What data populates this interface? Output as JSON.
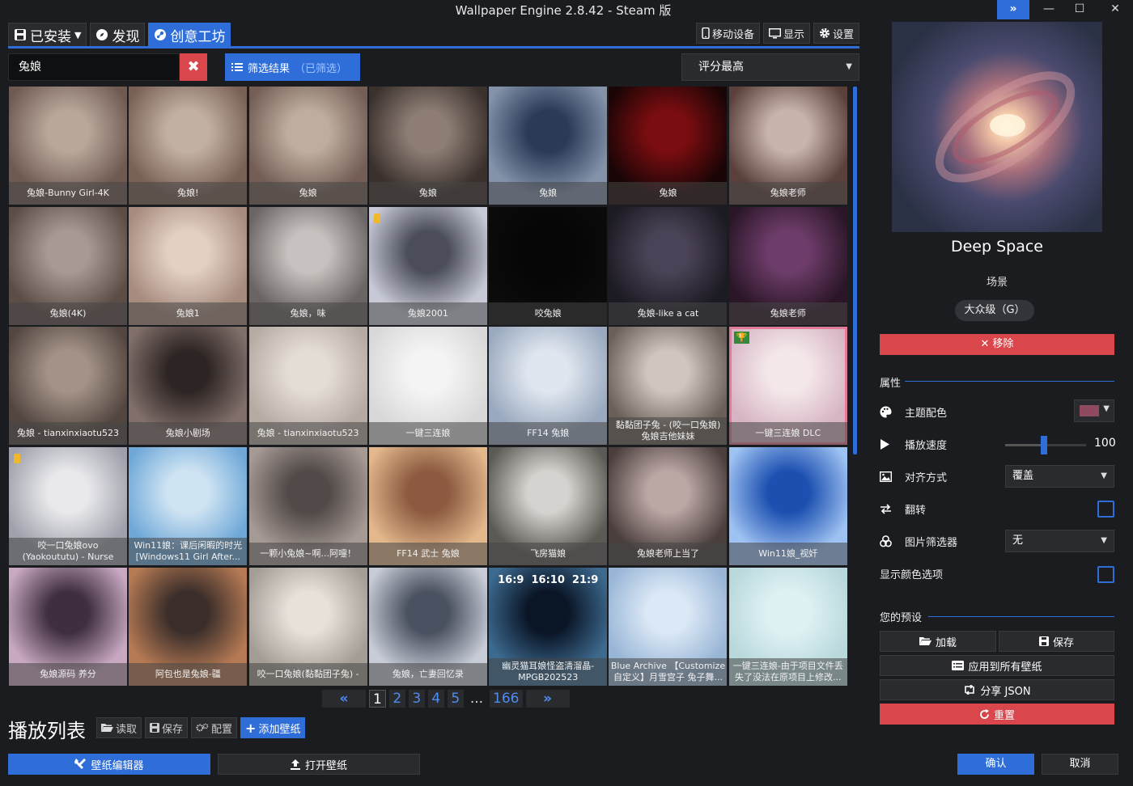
{
  "window": {
    "title": "Wallpaper Engine 2.8.42 - Steam 版",
    "expand_glyph": "»",
    "min_glyph": "—",
    "max_glyph": "☐",
    "close_glyph": "✕"
  },
  "tabs": [
    {
      "label": "已安装",
      "icon": "save-icon"
    },
    {
      "label": "发现",
      "icon": "compass-icon"
    },
    {
      "label": "创意工坊",
      "icon": "steam-icon"
    }
  ],
  "tools": {
    "mobile": "移动设备",
    "display": "显示",
    "settings": "设置"
  },
  "search": {
    "value": "兔娘",
    "clear_glyph": "✖"
  },
  "filter": {
    "label": "筛选结果",
    "status": "（已筛选）"
  },
  "sort": {
    "value": "评分最高"
  },
  "colors": {
    "accent": "#2f6ed8",
    "danger": "#d9464b"
  },
  "items": [
    {
      "title": "兔娘-Bunny Girl-4K"
    },
    {
      "title": "兔娘!"
    },
    {
      "title": "兔娘"
    },
    {
      "title": "兔娘"
    },
    {
      "title": "兔娘"
    },
    {
      "title": "兔娘"
    },
    {
      "title": "兔娘老师"
    },
    {
      "title": "兔娘(4K)"
    },
    {
      "title": "兔娘1"
    },
    {
      "title": "兔娘，味"
    },
    {
      "title": "兔娘2001"
    },
    {
      "title": "咬兔娘"
    },
    {
      "title": "兔娘-like a cat"
    },
    {
      "title": "兔娘老师"
    },
    {
      "title": "兔娘 - tianxinxiaotu523"
    },
    {
      "title": "兔娘小剧场"
    },
    {
      "title": "兔娘 - tianxinxiaotu523"
    },
    {
      "title": "一键三连娘"
    },
    {
      "title": "FF14 兔娘"
    },
    {
      "title": "黏黏团子兔 - (咬一口兔娘) 兔娘吉他妹妹"
    },
    {
      "title": "一键三连娘 DLC"
    },
    {
      "title": "咬一口兔娘ovo (Yaokoututu) - Nurse"
    },
    {
      "title": "Win11娘：课后闲暇的时光 [Windows11 Girl After..."
    },
    {
      "title": "一颗小兔娘~啊...阿嚏！"
    },
    {
      "title": "FF14 武士 兔娘"
    },
    {
      "title": "飞房猫娘"
    },
    {
      "title": "兔娘老师上当了"
    },
    {
      "title": "Win11娘_视奸"
    },
    {
      "title": "兔娘源码 养分"
    },
    {
      "title": "阿包也是兔娘-疆"
    },
    {
      "title": "咬一口兔娘(黏黏团子兔) -"
    },
    {
      "title": "兔娘，亡妻回忆录"
    },
    {
      "title": "幽灵猫耳娘怪盗清溜晶-MPGB202523",
      "overlay": "16:9  16:10  21:9"
    },
    {
      "title": "Blue Archive 【Customize 自定义】月雪宫子 兔子舞..."
    },
    {
      "title": "一键三连娘-由于项目文件丢失了没法在原项目上修改..."
    }
  ],
  "pagination": {
    "prev": "«",
    "pages": [
      "1",
      "2",
      "3",
      "4",
      "5"
    ],
    "dots": "...",
    "last": "166",
    "next": "»"
  },
  "playlist": {
    "title": "播放列表",
    "load": "读取",
    "save": "保存",
    "config": "配置",
    "add": "添加壁纸"
  },
  "bottom": {
    "editor": "壁纸编辑器",
    "open": "打开壁纸"
  },
  "detail": {
    "title": "Deep Space",
    "type": "场景",
    "rating": "大众级（G）",
    "remove": "✕ 移除",
    "properties_header": "属性",
    "color_label": "主题配色",
    "color_value": "#8f4a60",
    "speed_label": "播放速度",
    "speed_value": "100",
    "speed_fraction": 0.48,
    "align_label": "对齐方式",
    "align_value": "覆盖",
    "flip_label": "翻转",
    "filter_label": "图片筛选器",
    "filter_value": "无",
    "showcolor_label": "显示颜色选项",
    "presets_header": "您的预设",
    "load": "加载",
    "save": "保存",
    "apply_all": "应用到所有壁纸",
    "share_json": "分享 JSON",
    "reset": "重置"
  },
  "footer": {
    "ok": "确认",
    "cancel": "取消"
  }
}
